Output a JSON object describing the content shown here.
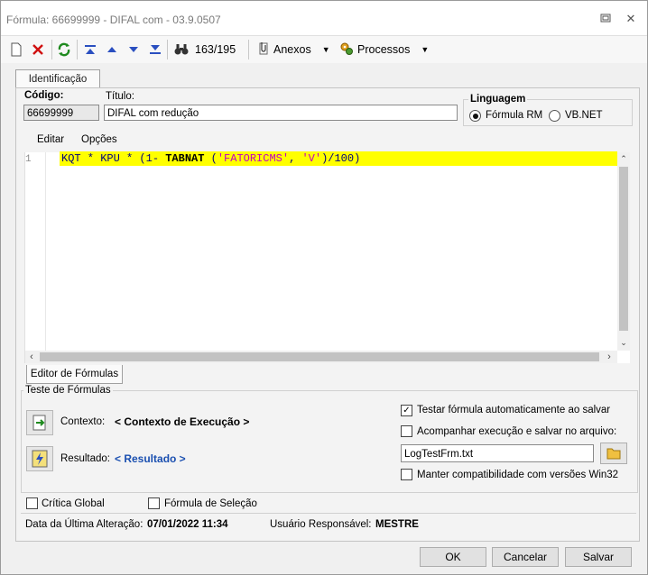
{
  "window": {
    "title": "Fórmula: 66699999 - DIFAL com  - 03.9.0507",
    "restore_icon": "restore-icon",
    "close_icon": "close-icon"
  },
  "toolbar": {
    "record_position": "163/195",
    "attachments_label": "Anexos",
    "processes_label": "Processos",
    "icons": [
      "new-icon",
      "delete-icon",
      "refresh-icon",
      "first-icon",
      "previous-icon",
      "next-icon",
      "last-icon",
      "binoculars-icon",
      "attachment-icon",
      "gears-icon"
    ]
  },
  "tabs": {
    "main": "Identificação",
    "editor": "Editor de Fórmulas"
  },
  "identification": {
    "code_label": "Código:",
    "code_value": "66699999",
    "title_label": "Título:",
    "title_value": "DIFAL com redução"
  },
  "language": {
    "label": "Linguagem",
    "options": [
      {
        "label": "Fórmula RM",
        "selected": true
      },
      {
        "label": "VB.NET",
        "selected": false
      }
    ]
  },
  "editor": {
    "menu": [
      "Editar",
      "Opções"
    ],
    "line_number": "1",
    "code_tokens": [
      {
        "text": "KQT * KPU * (1- ",
        "color": "#00007f",
        "bold": false
      },
      {
        "text": "TABNAT",
        "color": "#000000",
        "bold": true
      },
      {
        "text": " (",
        "color": "#00007f",
        "bold": false
      },
      {
        "text": "'FATORICMS'",
        "color": "#c000c0",
        "bold": false
      },
      {
        "text": ", ",
        "color": "#00007f",
        "bold": false
      },
      {
        "text": "'V'",
        "color": "#c000c0",
        "bold": false
      },
      {
        "text": ")/100)",
        "color": "#00007f",
        "bold": false
      }
    ],
    "highlight_color": "#ffff00"
  },
  "test": {
    "label": "Teste de Fórmulas",
    "context_label": "Contexto:",
    "context_value": "< Contexto de Execução >",
    "result_label": "Resultado:",
    "result_value": "< Resultado >",
    "auto_test_label": "Testar fórmula automaticamente ao salvar",
    "auto_test_checked": true,
    "follow_label": "Acompanhar execução e salvar no arquivo:",
    "follow_checked": false,
    "file_value": "LogTestFrm.txt",
    "compat_label": "Manter compatibilidade com versões Win32",
    "compat_checked": false
  },
  "flags": {
    "critical_label": "Crítica Global",
    "selection_label": "Fórmula de Seleção"
  },
  "footer": {
    "last_change_label": "Data da Última Alteração:",
    "last_change_value": "07/01/2022 11:34",
    "user_label": "Usuário Responsável:",
    "user_value": "MESTRE"
  },
  "buttons": {
    "ok": "OK",
    "cancel": "Cancelar",
    "save": "Salvar"
  },
  "colors": {
    "link": "#1a4fb0",
    "checkmark": "#111111"
  }
}
